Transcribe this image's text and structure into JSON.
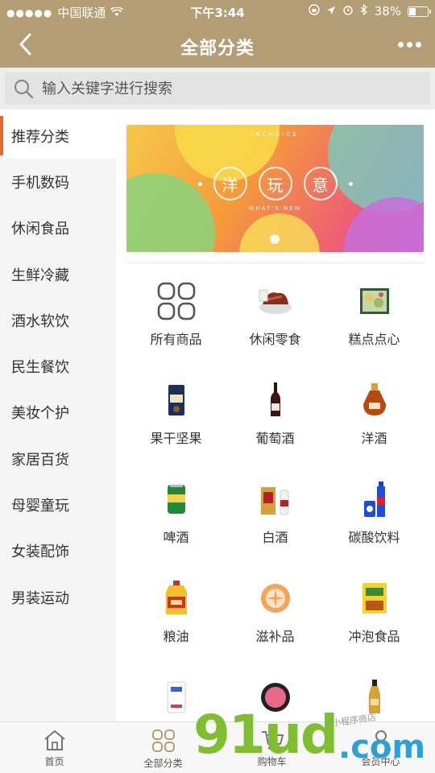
{
  "status_bar": {
    "carrier": "中国联通",
    "time": "下午3:44",
    "battery": "38%",
    "battery_level": 0.38
  },
  "nav": {
    "title": "全部分类",
    "back_icon": "chevron-left-icon",
    "more_icon": "more-dots-icon"
  },
  "search": {
    "placeholder": "输入关键字进行搜索"
  },
  "sidebar": {
    "items": [
      {
        "label": "推荐分类",
        "active": true
      },
      {
        "label": "手机数码"
      },
      {
        "label": "休闲食品"
      },
      {
        "label": "生鲜冷藏"
      },
      {
        "label": "酒水软饮"
      },
      {
        "label": "民生餐饮"
      },
      {
        "label": "美妆个护"
      },
      {
        "label": "家居百货"
      },
      {
        "label": "母婴童玩"
      },
      {
        "label": "女装配饰"
      },
      {
        "label": "男装运动"
      }
    ]
  },
  "banner": {
    "top_text": "INCHOICE",
    "chars": [
      "洋",
      "玩",
      "意"
    ],
    "bottom_text": "WHAT'S NEW"
  },
  "categories": [
    {
      "label": "所有商品",
      "icon": "grid-icon"
    },
    {
      "label": "休闲零食",
      "icon": "snack-image"
    },
    {
      "label": "糕点点心",
      "icon": "pastry-image"
    },
    {
      "label": "果干坚果",
      "icon": "nuts-image"
    },
    {
      "label": "葡萄酒",
      "icon": "wine-bottle-image"
    },
    {
      "label": "洋酒",
      "icon": "liquor-bottle-image"
    },
    {
      "label": "啤酒",
      "icon": "beer-can-image"
    },
    {
      "label": "白酒",
      "icon": "baijiu-image"
    },
    {
      "label": "碳酸饮料",
      "icon": "soda-bottle-image"
    },
    {
      "label": "粮油",
      "icon": "oil-bottle-image"
    },
    {
      "label": "滋补品",
      "icon": "tonic-image"
    },
    {
      "label": "冲泡食品",
      "icon": "instant-food-image"
    },
    {
      "label": "",
      "icon": "mask-image"
    },
    {
      "label": "",
      "icon": "blush-image"
    },
    {
      "label": "",
      "icon": "perfume-image"
    }
  ],
  "tabbar": {
    "tabs": [
      {
        "label": "首页",
        "icon": "home-icon"
      },
      {
        "label": "全部分类",
        "icon": "category-icon",
        "active": true
      },
      {
        "label": "购物车",
        "icon": "cart-icon"
      },
      {
        "label": "会员中心",
        "icon": "user-icon"
      }
    ]
  },
  "watermark": {
    "text": "91ud",
    "domain": ".com",
    "note": "小程序商店"
  },
  "colors": {
    "header": "#b39d74",
    "accent": "#e76b2e",
    "sidebar_bg": "#f5f5f5"
  }
}
